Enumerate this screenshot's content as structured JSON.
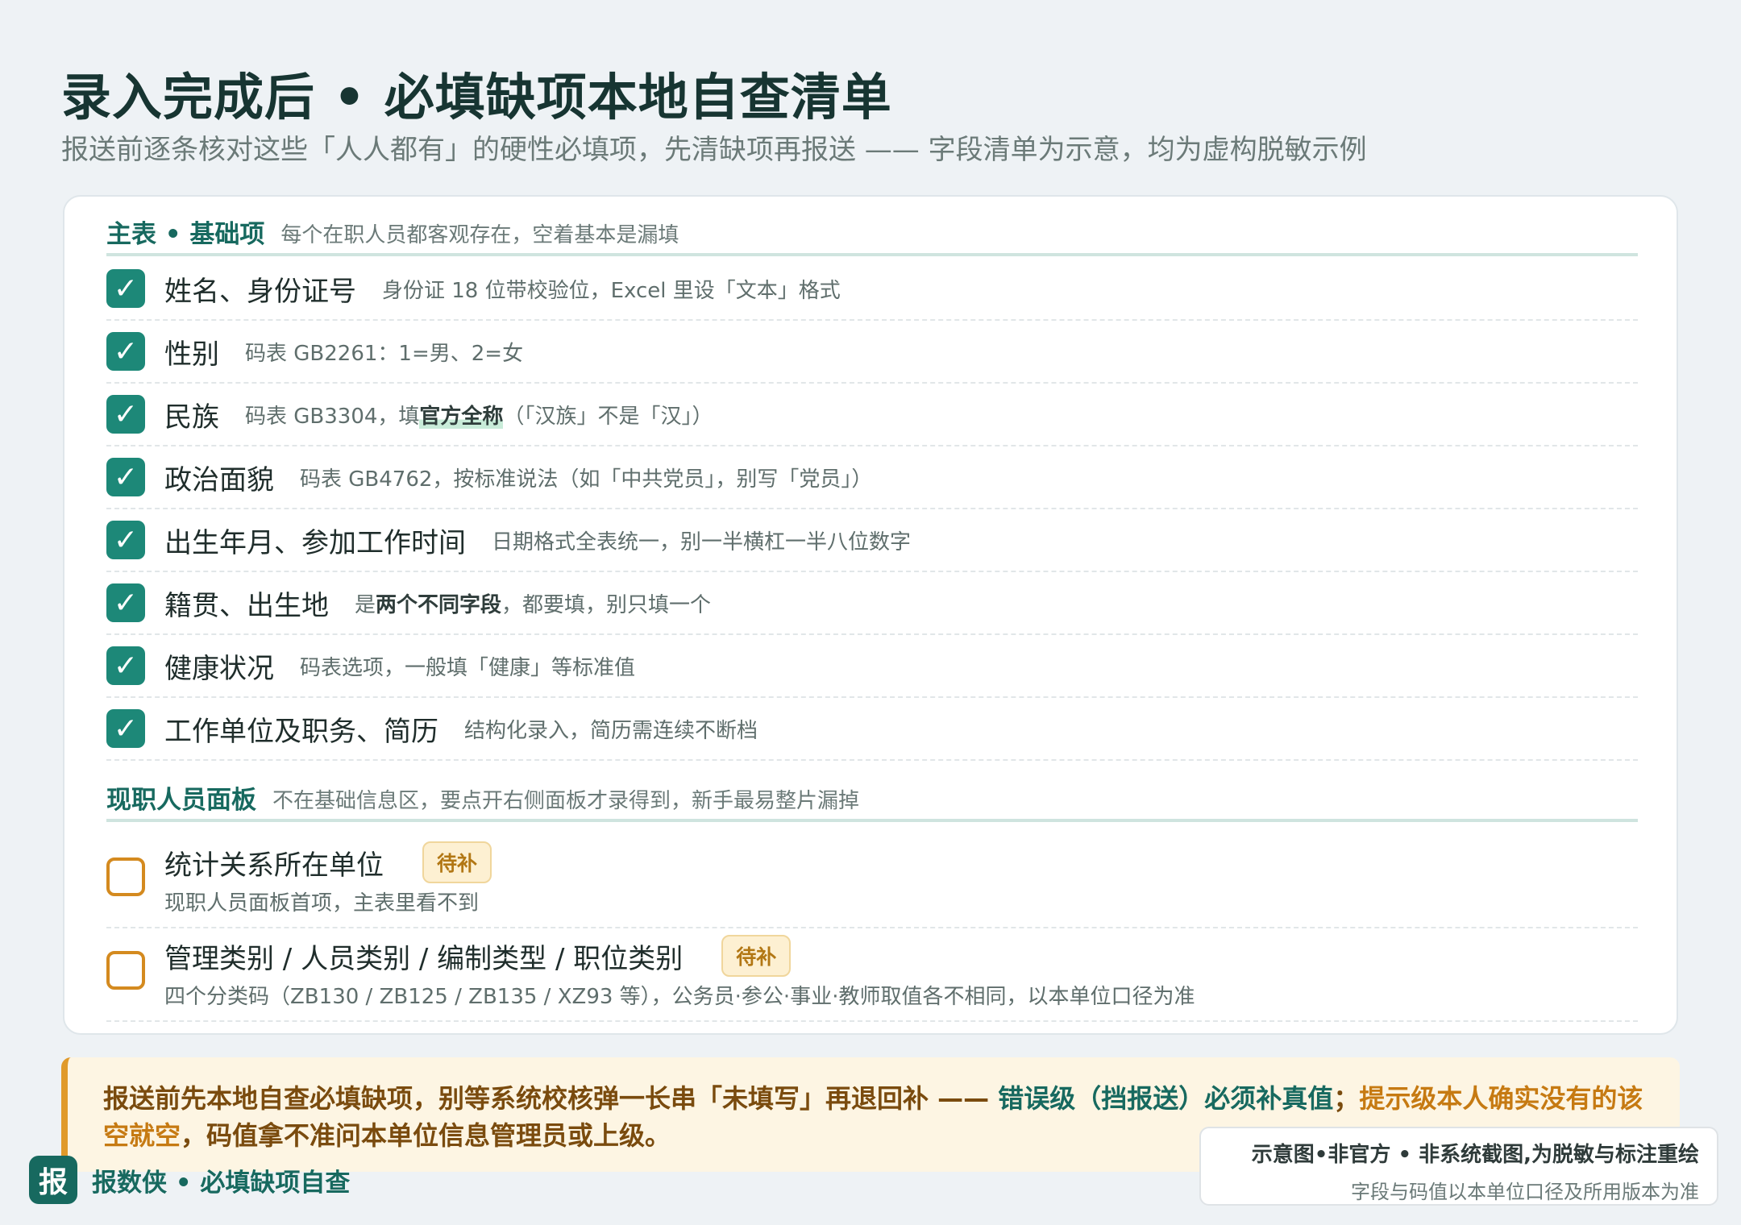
{
  "header": {
    "title": "录入完成后 • 必填缺项本地自查清单",
    "subtitle": "报送前逐条核对这些「人人都有」的硬性必填项，先清缺项再报送 —— 字段清单为示意，均为虚构脱敏示例"
  },
  "section1": {
    "title": "主表 • 基础项",
    "note": "每个在职人员都客观存在，空着基本是漏填",
    "check_glyph": "✓",
    "items": [
      {
        "label": "姓名、身份证号",
        "note": "身份证 18 位带校验位，Excel 里设「文本」格式"
      },
      {
        "label": "性别",
        "note": "码表 GB2261：1=男、2=女"
      },
      {
        "label": "民族",
        "note_pre": "码表 GB3304，填",
        "note_hl": "官方全称",
        "note_post": "（「汉族」不是「汉」）"
      },
      {
        "label": "政治面貌",
        "note": "码表 GB4762，按标准说法（如「中共党员」，别写「党员」）"
      },
      {
        "label": "出生年月、参加工作时间",
        "note": "日期格式全表统一，别一半横杠一半八位数字"
      },
      {
        "label": "籍贯、出生地",
        "note_pre": "是",
        "note_hl": "两个不同字段",
        "note_post": "，都要填，别只填一个"
      },
      {
        "label": "健康状况",
        "note": "码表选项，一般填「健康」等标准值"
      },
      {
        "label": "工作单位及职务、简历",
        "note": "结构化录入，简历需连续不断档"
      }
    ]
  },
  "section2": {
    "title": "现职人员面板",
    "note": "不在基础信息区，要点开右侧面板才录得到，新手最易整片漏掉",
    "items": [
      {
        "label": "统计关系所在单位",
        "badge": "待补",
        "note": "现职人员面板首项，主表里看不到"
      },
      {
        "label": "管理类别 / 人员类别 / 编制类型 / 职位类别",
        "badge": "待补",
        "note": "四个分类码（ZB130 / ZB125 / ZB135 / XZ93 等），公务员·参公·事业·教师取值各不相同，以本单位口径为准"
      }
    ]
  },
  "callout": {
    "part1": "报送前先本地自查必填缺项，别等系统校核弹一长串「未填写」再退回补 —— ",
    "part2": "错误级（挡报送）必须补真值",
    "part3": "；",
    "part4": "提示级本人确实没有的该空就空",
    "part5": "，码值拿不准问本单位信息管理员或上级。"
  },
  "brand": {
    "icon_char": "报",
    "name": "报数侠 • 必填缺项自查"
  },
  "disclaimer": {
    "line1": "示意图•非官方 • 非系统截图,为脱敏与标注重绘",
    "line2": "字段与码值以本单位口径及所用版本为准"
  },
  "colors": {
    "accent": "#17695f",
    "check_fill": "#1d8878",
    "pending_border": "#d48a1f",
    "callout_bg": "#fdf5e3"
  },
  "icons": {
    "checked": "checkbox-checked-icon",
    "unchecked": "checkbox-empty-icon"
  }
}
